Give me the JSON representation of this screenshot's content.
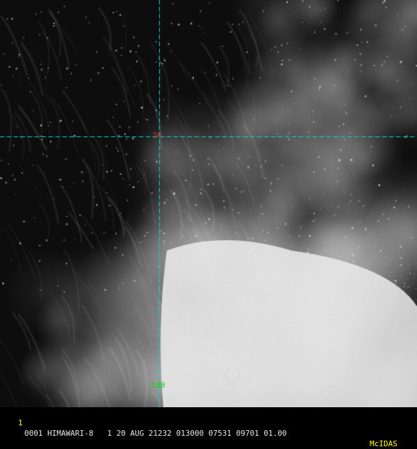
{
  "image": {
    "kind": "satellite-visible-imagery",
    "palette": {
      "ocean": "#0d0d0d",
      "cloud": "#e8e8e8",
      "grid_line": "#00d8d8",
      "lat_label_color": "#c83232",
      "lon_label_color": "#00d800",
      "frame_color": "#ffff00",
      "info_color": "#e6e6e6",
      "logo_color": "#ffff00"
    }
  },
  "grid": {
    "latitude_label": "20",
    "longitude_label": "-130"
  },
  "status_bar": {
    "frame_number": "1",
    "info_text": "0001 HIMAWARI-8   1 20 AUG 21232 013000 07531 09701 01.00",
    "logo": "McIDAS"
  }
}
